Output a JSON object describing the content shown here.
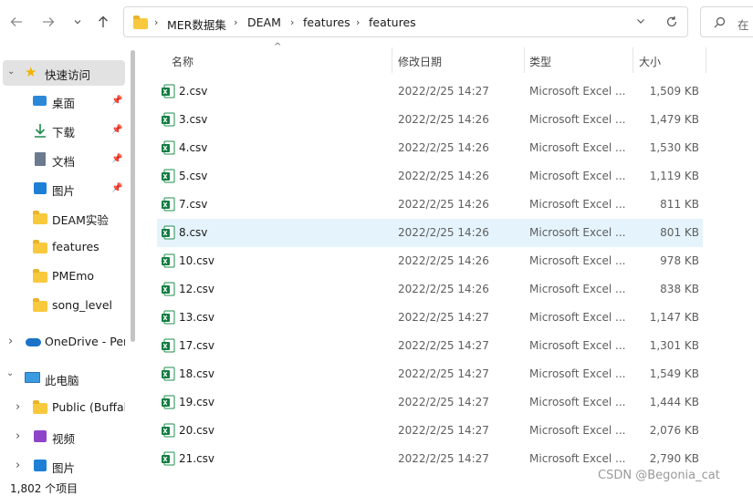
{
  "address": {
    "crumbs": [
      "MER数据集",
      "DEAM",
      "features",
      "features"
    ],
    "search_placeholder": "在"
  },
  "sidebar": {
    "quick_access": "快速访问",
    "items": [
      {
        "label": "桌面",
        "icon": "desktop-icon",
        "pinned": true
      },
      {
        "label": "下载",
        "icon": "download-icon",
        "pinned": true
      },
      {
        "label": "文档",
        "icon": "document-icon",
        "pinned": true
      },
      {
        "label": "图片",
        "icon": "pictures-icon",
        "pinned": true
      },
      {
        "label": "DEAM实验",
        "icon": "folder-icon",
        "pinned": false
      },
      {
        "label": "features",
        "icon": "folder-icon",
        "pinned": false
      },
      {
        "label": "PMEmo",
        "icon": "folder-icon",
        "pinned": false
      },
      {
        "label": "song_level",
        "icon": "folder-icon",
        "pinned": false
      }
    ],
    "onedrive": "OneDrive - Pers",
    "this_pc": "此电脑",
    "pc_items": [
      {
        "label": "Public (Buffalo",
        "icon": "folder-icon"
      },
      {
        "label": "视频",
        "icon": "video-icon"
      },
      {
        "label": "图片",
        "icon": "pictures-icon"
      }
    ]
  },
  "columns": {
    "name": "名称",
    "date": "修改日期",
    "type": "类型",
    "size": "大小"
  },
  "files": [
    {
      "name": "2.csv",
      "date": "2022/2/25 14:27",
      "type": "Microsoft Excel ...",
      "size": "1,509 KB"
    },
    {
      "name": "3.csv",
      "date": "2022/2/25 14:26",
      "type": "Microsoft Excel ...",
      "size": "1,479 KB"
    },
    {
      "name": "4.csv",
      "date": "2022/2/25 14:26",
      "type": "Microsoft Excel ...",
      "size": "1,530 KB"
    },
    {
      "name": "5.csv",
      "date": "2022/2/25 14:26",
      "type": "Microsoft Excel ...",
      "size": "1,119 KB"
    },
    {
      "name": "7.csv",
      "date": "2022/2/25 14:26",
      "type": "Microsoft Excel ...",
      "size": "811 KB"
    },
    {
      "name": "8.csv",
      "date": "2022/2/25 14:26",
      "type": "Microsoft Excel ...",
      "size": "801 KB"
    },
    {
      "name": "10.csv",
      "date": "2022/2/25 14:26",
      "type": "Microsoft Excel ...",
      "size": "978 KB"
    },
    {
      "name": "12.csv",
      "date": "2022/2/25 14:26",
      "type": "Microsoft Excel ...",
      "size": "838 KB"
    },
    {
      "name": "13.csv",
      "date": "2022/2/25 14:27",
      "type": "Microsoft Excel ...",
      "size": "1,147 KB"
    },
    {
      "name": "17.csv",
      "date": "2022/2/25 14:27",
      "type": "Microsoft Excel ...",
      "size": "1,301 KB"
    },
    {
      "name": "18.csv",
      "date": "2022/2/25 14:27",
      "type": "Microsoft Excel ...",
      "size": "1,549 KB"
    },
    {
      "name": "19.csv",
      "date": "2022/2/25 14:27",
      "type": "Microsoft Excel ...",
      "size": "1,444 KB"
    },
    {
      "name": "20.csv",
      "date": "2022/2/25 14:27",
      "type": "Microsoft Excel ...",
      "size": "2,076 KB"
    },
    {
      "name": "21.csv",
      "date": "2022/2/25 14:27",
      "type": "Microsoft Excel ...",
      "size": "2,790 KB"
    }
  ],
  "selected_file_index": 5,
  "status": {
    "item_count": "1,802 个项目"
  },
  "watermark": "CSDN @Begonia_cat",
  "colors": {
    "selected_row": "#e5f3fd",
    "excel_green": "#107c41",
    "folder": "#f8c93d",
    "sidebar_selected": "#e2e2e2"
  }
}
